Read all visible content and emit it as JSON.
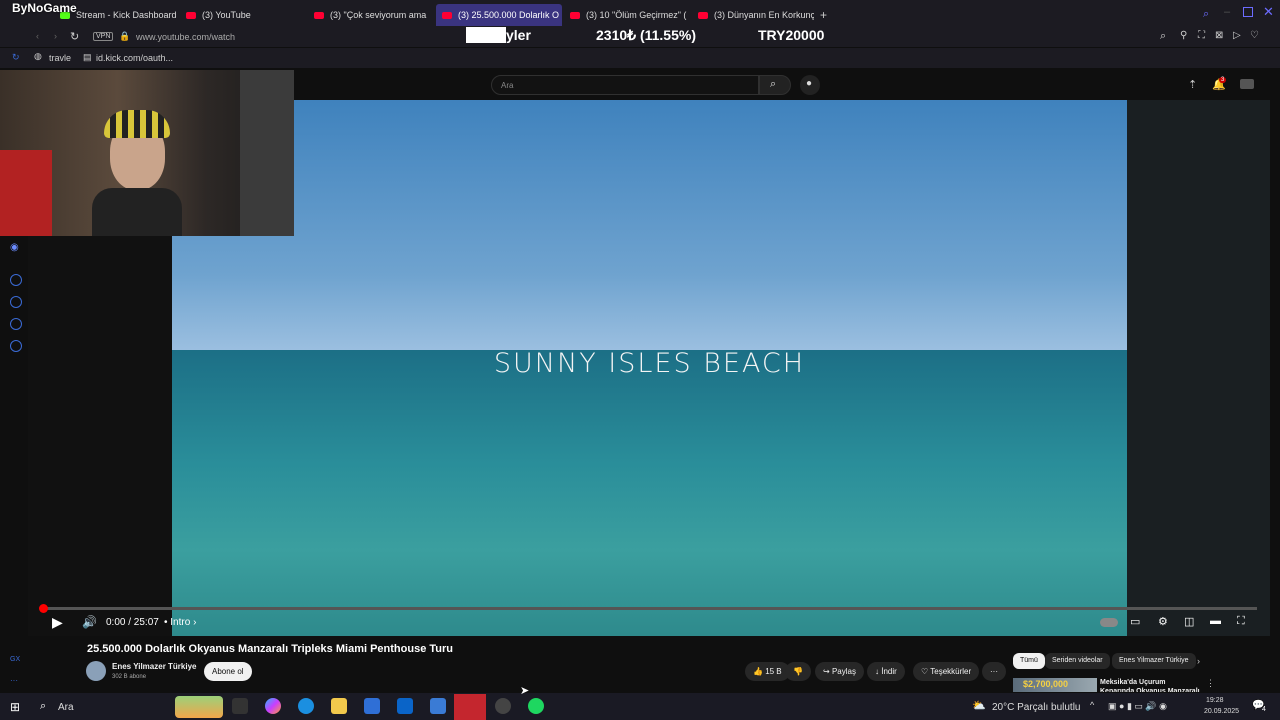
{
  "stream_brand": "ByNoGame",
  "tabs": [
    {
      "label": "Stream - Kick Dashboard",
      "kind": "kick"
    },
    {
      "label": "(3) YouTube",
      "kind": "yt"
    },
    {
      "label": "(3) \"Çok seviyorum ama",
      "kind": "yt"
    },
    {
      "label": "(3) 25.500.000 Dolarlık O",
      "kind": "yt",
      "active": true
    },
    {
      "label": "(3) 10 \"Ölüm Geçirmez\" (",
      "kind": "yt"
    },
    {
      "label": "(3) Dünyanın En Korkunç",
      "kind": "yt"
    }
  ],
  "address": {
    "vpn": "VPN",
    "url": "www.youtube.com/watch"
  },
  "bookmarks": [
    {
      "label": "travle"
    },
    {
      "label": "id.kick.com/oauth..."
    }
  ],
  "ticker": {
    "text1": "yler",
    "text2": "2310₺ (11.55%)",
    "text3": "TRY20000"
  },
  "youtube": {
    "search_placeholder": "Ara",
    "notification_count": "3",
    "video_overlay_text": "SUNNY ISLES BEACH",
    "watermark": "E y",
    "time": "0:00 / 25:07",
    "chapter": "• Intro ›",
    "progress_fraction": 0.0,
    "title": "25.500.000 Dolarlık Okyanus Manzaralı Tripleks Miami Penthouse Turu",
    "channel": "Enes Yilmazer Türkiye",
    "subscribers": "302 B abone",
    "subscribe_label": "Abone ol",
    "likes": "15 B",
    "share": "Paylaş",
    "download": "İndir",
    "thanks": "Teşekkürler",
    "chips": [
      "Tümü",
      "Seriden videolar",
      "Enes Yilmazer Türkiye"
    ],
    "next_video_price": "$2,700,000",
    "next_video_title": "Meksika'da Uçurum Kenarında Okyanus Manzaralı İnanılmaz"
  },
  "taskbar": {
    "search": "Ara",
    "weather": "20°C  Parçalı bulutlu",
    "time": "19:28",
    "date": "20.09.2025",
    "notif_count": "4"
  },
  "colors": {
    "accent": "#3a3480",
    "yt_red": "#ff0000",
    "kick_green": "#53fc18"
  }
}
